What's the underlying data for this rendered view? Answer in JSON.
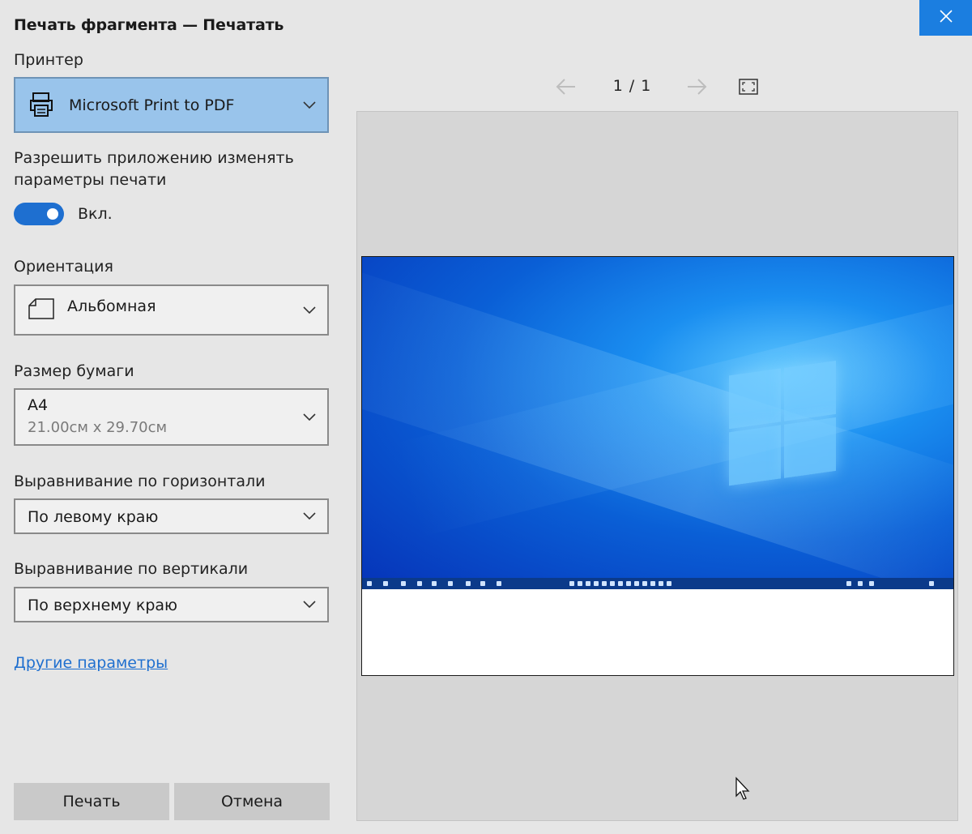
{
  "window": {
    "title": "Печать фрагмента — Печатать"
  },
  "printer": {
    "label": "Принтер",
    "value": "Microsoft Print to PDF"
  },
  "allow_app": {
    "label_line1": "Разрешить приложению изменять",
    "label_line2": "параметры печати",
    "toggle_state": "Вкл."
  },
  "orientation": {
    "label": "Ориентация",
    "value": "Альбомная"
  },
  "paper_size": {
    "label": "Размер бумаги",
    "value": "A4",
    "detail": "21.00см x 29.70см"
  },
  "halign": {
    "label": "Выравнивание по горизонтали",
    "value": "По левому краю"
  },
  "valign": {
    "label": "Выравнивание по вертикали",
    "value": "По верхнему краю"
  },
  "more_link": "Другие параметры",
  "buttons": {
    "print": "Печать",
    "cancel": "Отмена"
  },
  "pagination": {
    "current": "1",
    "separator": "/",
    "total": "1"
  },
  "icons": {
    "printer": "printer-icon",
    "orientation": "landscape-page-icon",
    "prev": "arrow-left-icon",
    "next": "arrow-right-icon",
    "fullscreen": "fullscreen-icon",
    "close": "close-icon",
    "dropdown": "chevron-down-icon"
  },
  "colors": {
    "accent": "#1e6fd0",
    "printer_bg": "#99c4eb",
    "close_bg": "#1b7ee0",
    "link": "#1f6fcf"
  }
}
